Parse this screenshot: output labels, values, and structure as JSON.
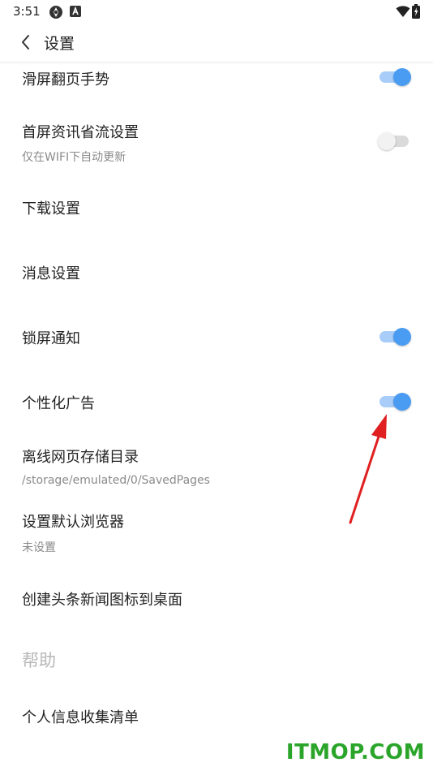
{
  "status_bar": {
    "time": "3:51",
    "icons": [
      "app-notification-icon",
      "a-badge-icon",
      "wifi-icon",
      "battery-charging-icon"
    ]
  },
  "header": {
    "title": "设置",
    "back_icon": "chevron-left-icon"
  },
  "settings": [
    {
      "label": "滑屏翻页手势",
      "toggle": true
    },
    {
      "label": "首屏资讯省流设置",
      "sub": "仅在WIFI下自动更新",
      "toggle": false
    },
    {
      "label": "下载设置"
    },
    {
      "label": "消息设置"
    },
    {
      "label": "锁屏通知",
      "toggle": true
    },
    {
      "label": "个性化广告",
      "toggle": true
    },
    {
      "label": "离线网页存储目录",
      "sub": "/storage/emulated/0/SavedPages"
    },
    {
      "label": "设置默认浏览器",
      "sub": "未设置"
    },
    {
      "label": "创建头条新闻图标到桌面"
    }
  ],
  "help_section": {
    "title": "帮助",
    "items": [
      {
        "label": "个人信息收集清单"
      }
    ]
  },
  "colors": {
    "toggle_on_knob": "#4a9cf3",
    "toggle_on_track": "#a8cdf8",
    "toggle_off_track": "#dadada",
    "annotation_arrow": "#e02020",
    "watermark": "#2aa52a"
  },
  "watermark": "ITMOP.COM"
}
